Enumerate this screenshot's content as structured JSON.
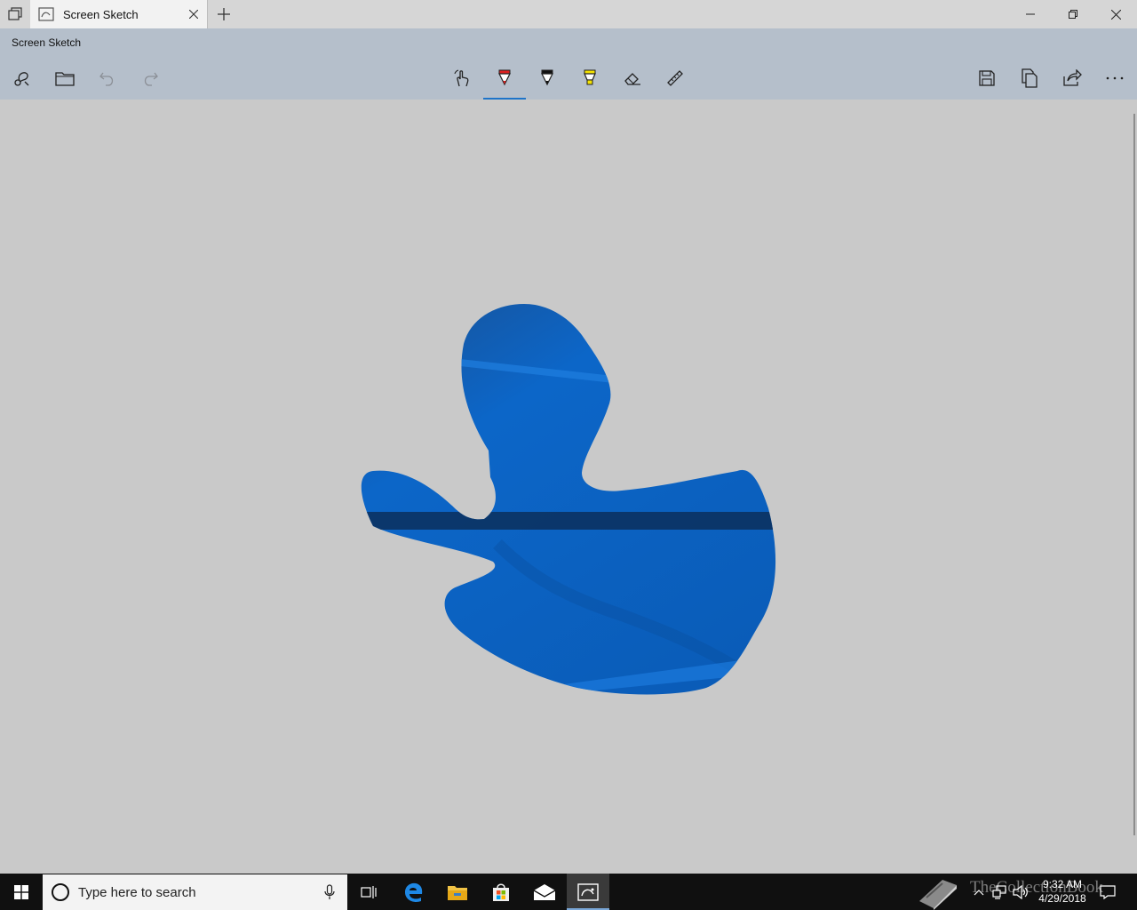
{
  "window": {
    "tab_title": "Screen Sketch",
    "app_title": "Screen Sketch"
  },
  "toolbar": {
    "left": [
      {
        "name": "new-snip-icon"
      },
      {
        "name": "open-folder-icon"
      },
      {
        "name": "undo-icon"
      },
      {
        "name": "redo-icon"
      }
    ],
    "center": [
      {
        "name": "touch-writing-icon"
      },
      {
        "name": "ballpoint-pen-icon",
        "color": "#e02020",
        "active": true
      },
      {
        "name": "pencil-icon",
        "color": "#111111"
      },
      {
        "name": "highlighter-icon",
        "color": "#f5e400"
      },
      {
        "name": "eraser-icon"
      },
      {
        "name": "ruler-icon"
      }
    ],
    "right": [
      {
        "name": "save-icon"
      },
      {
        "name": "copy-icon"
      },
      {
        "name": "share-icon"
      },
      {
        "name": "more-icon"
      }
    ]
  },
  "canvas": {
    "background": "#c9c9c9",
    "snip_fill": "#0b63c4"
  },
  "taskbar": {
    "search_placeholder": "Type here to search",
    "time": "9:32 AM",
    "date": "4/29/2018",
    "watermark": "TheCollectionBook",
    "apps": [
      "task-view-icon",
      "edge-icon",
      "file-explorer-icon",
      "store-icon",
      "mail-icon",
      "screen-sketch-icon"
    ]
  }
}
